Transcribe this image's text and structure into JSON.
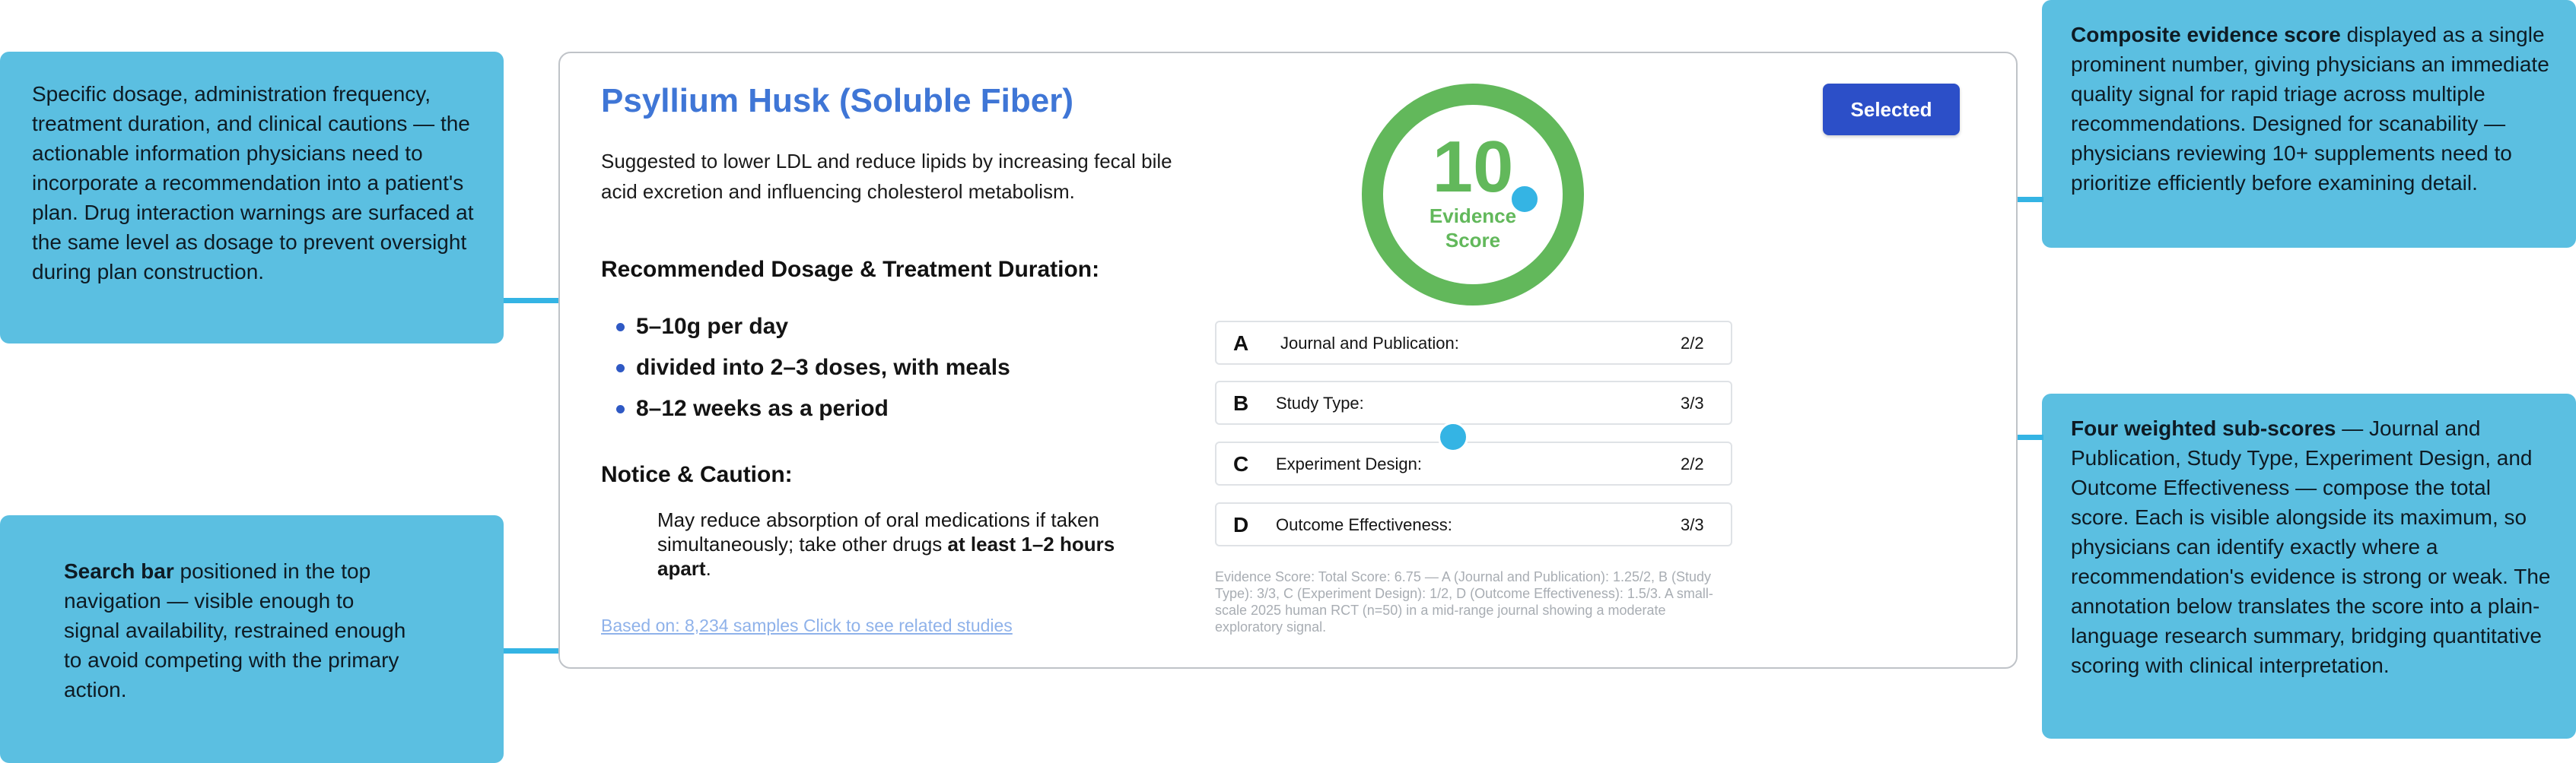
{
  "annotations": {
    "dosage_note": {
      "text": "Specific dosage, administration frequency, treatment duration, and clinical cautions — the actionable information physicians need to incorporate a recommendation into a patient's plan. Drug interaction warnings are surfaced at the same level as dosage to prevent oversight during plan construction."
    },
    "search_note": {
      "bold": "Search bar",
      "text": " positioned in the top navigation — visible enough to signal availability, restrained enough to avoid competing with the primary action."
    },
    "score_note": {
      "bold": "Composite evidence score",
      "text": " displayed as a single prominent number, giving physicians an immediate quality signal for rapid triage across multiple recommendations. Designed for scanability — physicians reviewing 10+ supplements need to prioritize efficiently before examining detail."
    },
    "subscore_note": {
      "bold": "Four weighted sub-scores",
      "text": " — Journal and Publication, Study Type, Experiment Design, and Outcome Effectiveness — compose the total score. Each is visible alongside its maximum, so physicians can identify exactly where a recommendation's evidence is strong or weak. The annotation below translates the score into a plain-language research summary, bridging quantitative scoring with clinical interpretation."
    }
  },
  "card": {
    "title": "Psyllium Husk (Soluble Fiber)",
    "description": "Suggested to lower LDL and reduce lipids by increasing fecal bile acid excretion and influencing cholesterol metabolism.",
    "dosage_heading": "Recommended Dosage & Treatment Duration:",
    "dosage_items": [
      "5–10g per day",
      "divided into 2–3 doses, with meals",
      "8–12 weeks as a period"
    ],
    "caution_heading": "Notice & Caution:",
    "caution_text_before": "May reduce absorption of oral medications if taken simultaneously; take other drugs ",
    "caution_text_bold": "at least 1–2 hours apart",
    "caution_text_after": ".",
    "based_on": "Based on: 8,234 samples Click to see related studies",
    "selected_button": "Selected",
    "score": {
      "value": "10",
      "label_line1": "Evidence",
      "label_line2": "Score",
      "ring_color": "#62b85b"
    },
    "subscores": [
      {
        "letter": "A",
        "label": "Journal and Publication:",
        "value": "2/2"
      },
      {
        "letter": "B",
        "label": "Study Type:",
        "value": "3/3"
      },
      {
        "letter": "C",
        "label": "Experiment Design:",
        "value": "2/2"
      },
      {
        "letter": "D",
        "label": "Outcome Effectiveness:",
        "value": "3/3"
      }
    ],
    "evidence_note": "Evidence Score: Total Score: 6.75 — A (Journal and Publication): 1.25/2, B (Study Type): 3/3, C (Experiment Design): 1/2, D (Outcome Effectiveness): 1.5/3. A small-scale 2025 human RCT (n=50) in a mid-range journal showing a moderate exploratory signal."
  },
  "colors": {
    "accent_blue": "#3f76d6",
    "button_blue": "#2c4fc8",
    "annotation_bg": "#5bbfe1",
    "connector": "#34b4e4",
    "score_green": "#62b85b"
  }
}
